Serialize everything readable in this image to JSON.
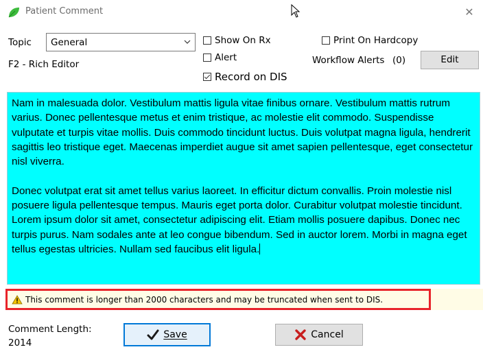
{
  "window": {
    "title": "Patient Comment",
    "close_symbol": "✕"
  },
  "header": {
    "topic_label": "Topic",
    "topic_value": "General",
    "editor_hint": "F2 - Rich Editor",
    "show_on_rx": {
      "label": "Show On Rx",
      "checked": false
    },
    "alert": {
      "label": "Alert",
      "checked": false
    },
    "record_on_dis": {
      "label": "Record on DIS",
      "checked": true
    },
    "print_on_hardcopy": {
      "label": "Print On Hardcopy",
      "checked": false
    },
    "workflow_alerts_label": "Workflow Alerts",
    "workflow_alerts_count": "(0)",
    "edit_label": "Edit"
  },
  "editor": {
    "background": "#00ffff",
    "paragraphs": [
      "Nam in malesuada dolor. Vestibulum mattis ligula vitae finibus ornare. Vestibulum mattis rutrum varius. Donec pellentesque metus et enim tristique, ac molestie elit commodo. Suspendisse vulputate et turpis vitae mollis. Duis commodo tincidunt luctus. Duis volutpat magna ligula, hendrerit sagittis leo tristique eget. Maecenas imperdiet augue sit amet sapien pellentesque, eget consectetur nisl viverra.",
      "Donec volutpat erat sit amet tellus varius laoreet. In efficitur dictum convallis. Proin molestie nisl posuere ligula pellentesque tempus. Mauris eget porta dolor. Curabitur volutpat molestie tincidunt. Lorem ipsum dolor sit amet, consectetur adipiscing elit. Etiam mollis posuere dapibus. Donec nec turpis purus. Nam sodales ante at leo congue bibendum. Sed in auctor lorem. Morbi in magna eget tellus egestas ultricies. Nullam sed faucibus elit ligula."
    ]
  },
  "warning": {
    "icon": "warning-triangle-icon",
    "text": "This comment is longer than 2000 characters and may be truncated when sent to DIS.",
    "highlight_color": "#e8232a"
  },
  "footer": {
    "length_label": "Comment Length:",
    "length_value": "2014",
    "save_label": "Save",
    "cancel_label": "Cancel"
  }
}
